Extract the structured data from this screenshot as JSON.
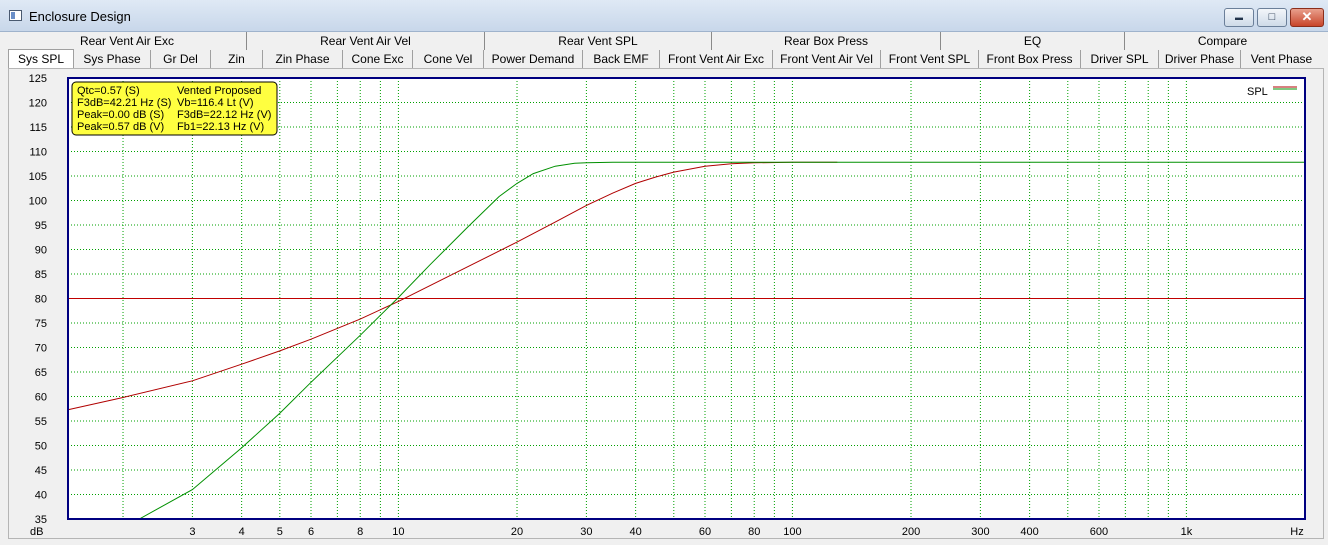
{
  "window": {
    "title": "Enclosure Design",
    "minimize_glyph": "▬",
    "maximize_glyph": "□",
    "close_glyph": "✕"
  },
  "tabs_row1": [
    "Rear Vent Air Exc",
    "Rear Vent Air Vel",
    "Rear Vent SPL",
    "Rear Box Press",
    "EQ",
    "Compare"
  ],
  "tabs_row2": [
    "Sys SPL",
    "Sys Phase",
    "Gr Del",
    "Zin",
    "Zin Phase",
    "Cone Exc",
    "Cone Vel",
    "Power Demand",
    "Back EMF",
    "Front Vent Air Exc",
    "Front Vent Air Vel",
    "Front Vent SPL",
    "Front Box Press",
    "Driver SPL",
    "Driver Phase",
    "Vent Phase"
  ],
  "active_tab": "Sys SPL",
  "info_box": {
    "left": [
      "Qtc=0.57 (S)",
      "F3dB=42.21 Hz (S)",
      "Peak=0.00 dB (S)",
      "Peak=0.57 dB (V)"
    ],
    "right": [
      "Vented Proposed",
      "Vb=116.4 Lt (V)",
      "F3dB=22.12 Hz (V)",
      "Fb1=22.13 Hz (V)"
    ]
  },
  "colors": {
    "sealed": "#b00000",
    "vented": "#009000",
    "reference": "#c00000",
    "grid": "#00a000",
    "info_bg": "#ffff40",
    "plot_border": "#000080"
  },
  "chart_data": {
    "type": "line",
    "x_scale": "log",
    "xlim": [
      1.45,
      2000
    ],
    "ylim": [
      35,
      125
    ],
    "x_ticks": [
      {
        "v": 3,
        "label": "3"
      },
      {
        "v": 4,
        "label": "4"
      },
      {
        "v": 5,
        "label": "5"
      },
      {
        "v": 6,
        "label": "6"
      },
      {
        "v": 8,
        "label": "8"
      },
      {
        "v": 10,
        "label": "10"
      },
      {
        "v": 20,
        "label": "20"
      },
      {
        "v": 30,
        "label": "30"
      },
      {
        "v": 40,
        "label": "40"
      },
      {
        "v": 60,
        "label": "60"
      },
      {
        "v": 80,
        "label": "80"
      },
      {
        "v": 100,
        "label": "100"
      },
      {
        "v": 200,
        "label": "200"
      },
      {
        "v": 300,
        "label": "300"
      },
      {
        "v": 400,
        "label": "400"
      },
      {
        "v": 600,
        "label": "600"
      },
      {
        "v": 1000,
        "label": "1k"
      }
    ],
    "x_unit": "Hz",
    "y_unit": "dB",
    "y_ticks": [
      35,
      40,
      45,
      50,
      55,
      60,
      65,
      70,
      75,
      80,
      85,
      90,
      95,
      100,
      105,
      110,
      115,
      120,
      125
    ],
    "grid": true,
    "legend": {
      "position": "top-right",
      "label": "SPL"
    },
    "reference_level": 80,
    "series": [
      {
        "key": "sealed",
        "x": [
          1.45,
          2,
          3,
          4,
          5,
          6,
          8,
          10,
          12,
          15,
          20,
          25,
          30,
          35,
          40,
          45,
          50,
          60,
          70,
          80,
          100,
          120,
          130
        ],
        "y": [
          57.3,
          59.8,
          63.2,
          66.6,
          69.3,
          71.7,
          75.8,
          79.4,
          82.6,
          86.5,
          91.5,
          95.6,
          99.0,
          101.5,
          103.5,
          104.8,
          105.8,
          107.0,
          107.5,
          107.7,
          107.8,
          107.8,
          107.8
        ]
      },
      {
        "key": "vented",
        "x": [
          1.45,
          2.2,
          3,
          4,
          5,
          6,
          8,
          10,
          12,
          15,
          18,
          20,
          22,
          25,
          28,
          30,
          35,
          40,
          60,
          100,
          300,
          1000,
          2000
        ],
        "y": [
          35,
          35,
          41.0,
          49.5,
          56.6,
          62.9,
          72.5,
          80.2,
          86.8,
          94.6,
          100.8,
          103.5,
          105.5,
          107.0,
          107.6,
          107.7,
          107.8,
          107.8,
          107.8,
          107.8,
          107.8,
          107.8,
          107.8
        ]
      }
    ]
  }
}
